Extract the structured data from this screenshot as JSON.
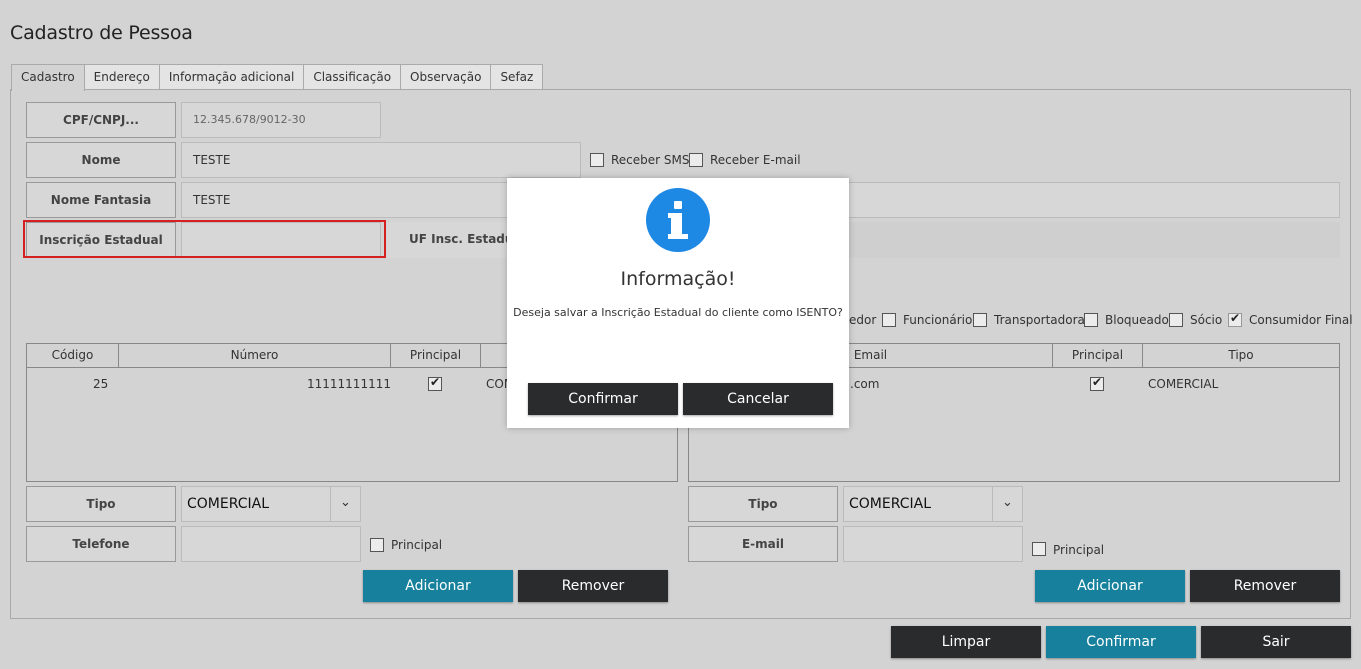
{
  "page": {
    "title": "Cadastro de Pessoa"
  },
  "tabs": [
    "Cadastro",
    "Endereço",
    "Informação adicional",
    "Classificação",
    "Observação",
    "Sefaz"
  ],
  "form": {
    "cpf_label": "CPF/CNPJ...",
    "cpf_value": "12.345.678/9012-30",
    "nome_label": "Nome",
    "nome_value": "TESTE",
    "fantasia_label": "Nome Fantasia",
    "fantasia_value": "TESTE",
    "ie_label": "Inscrição Estadual",
    "ie_value": "",
    "uf_ie_label": "UF Insc. Estadual",
    "receber_sms": "Receber SMS",
    "receber_email": "Receber E-mail"
  },
  "classificacao": {
    "fornecedor_partial": "edor",
    "funcionario": "Funcionário",
    "transportadora": "Transportadora",
    "bloqueado": "Bloqueado",
    "socio": "Sócio",
    "consumidor_final": "Consumidor Final"
  },
  "phones": {
    "headers": [
      "Código",
      "Número",
      "Principal"
    ],
    "rows": [
      {
        "codigo": "25",
        "numero": "11111111111",
        "principal": true,
        "tipo_partial": "COM"
      }
    ],
    "tipo_label": "Tipo",
    "tipo_value": "COMERCIAL",
    "telefone_label": "Telefone",
    "telefone_value": "",
    "principal_label": "Principal",
    "add_label": "Adicionar",
    "remove_label": "Remover"
  },
  "emails": {
    "headers": [
      "Email",
      "Principal",
      "Tipo"
    ],
    "rows": [
      {
        "email_partial": ".com",
        "principal": true,
        "tipo": "COMERCIAL"
      }
    ],
    "tipo_label": "Tipo",
    "tipo_value": "COMERCIAL",
    "email_label": "E-mail",
    "email_value": "",
    "principal_label": "Principal",
    "add_label": "Adicionar",
    "remove_label": "Remover"
  },
  "footer": {
    "limpar": "Limpar",
    "confirmar": "Confirmar",
    "sair": "Sair"
  },
  "dialog": {
    "title": "Informação!",
    "message": "Deseja salvar a Inscrição Estadual do cliente como ISENTO?",
    "confirm": "Confirmar",
    "cancel": "Cancelar"
  },
  "colors": {
    "accent": "#17809d",
    "dark_button": "#2a2b2d",
    "info_icon": "#1e88e5",
    "highlight": "#d42020"
  }
}
